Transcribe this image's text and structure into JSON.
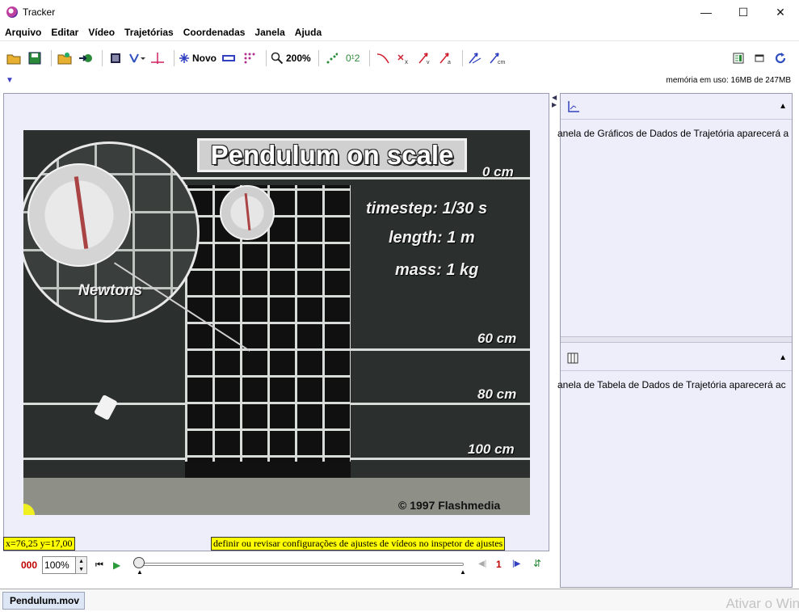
{
  "window": {
    "title": "Tracker",
    "minimize": "—",
    "maximize": "☐",
    "close": "✕"
  },
  "menu": [
    "Arquivo",
    "Editar",
    "Vídeo",
    "Trajetórias",
    "Coordenadas",
    "Janela",
    "Ajuda"
  ],
  "toolbar": {
    "new_label": "Novo",
    "zoom_label": "200%",
    "frame_label": "0¹2"
  },
  "status": {
    "memory": "memória em uso: 16MB de 247MB"
  },
  "video": {
    "title": "Pendulum on scale",
    "timestep": "timestep:  1/30  s",
    "length": "length:  1  m",
    "mass": "mass:  1  kg",
    "newtons": "Newtons",
    "marks": [
      "0 cm",
      "60 cm",
      "80 cm",
      "100 cm"
    ],
    "copyright": "© 1997 Flashmedia"
  },
  "coords": "x=76,25  y=17,00",
  "hint": "definir ou revisar configurações de ajustes de vídeos no inspetor de ajustes",
  "player": {
    "frame": "000",
    "zoom": "100%",
    "step": "1"
  },
  "panels": {
    "plot_text": "anela de Gráficos de Dados de Trajetória aparecerá a",
    "table_text": "anela de Tabela de Dados de Trajetória aparecerá ac"
  },
  "tab": "Pendulum.mov",
  "watermark": "Ativar o Windo",
  "colors": {
    "accent": "#c00000",
    "highlight": "#ffff00",
    "panel_bg": "#eeeefb"
  }
}
